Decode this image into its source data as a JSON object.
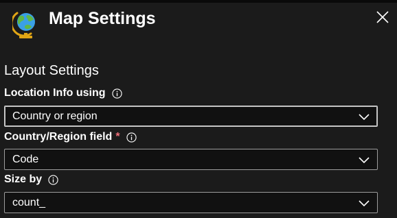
{
  "panel": {
    "title": "Map Settings",
    "icon": "globe-icon"
  },
  "layout_section": {
    "heading": "Layout Settings"
  },
  "fields": [
    {
      "label": "Location Info using",
      "required": false,
      "value": "Country or region"
    },
    {
      "label": "Country/Region field",
      "required": true,
      "required_mark": "*",
      "value": "Code"
    },
    {
      "label": "Size by",
      "required": false,
      "value": "count_"
    }
  ],
  "colors": {
    "panel_bg": "#1b1b1b",
    "input_bg": "#111111",
    "input_border": "#9e9e9e",
    "required": "#f1707b",
    "text": "#ffffff"
  }
}
